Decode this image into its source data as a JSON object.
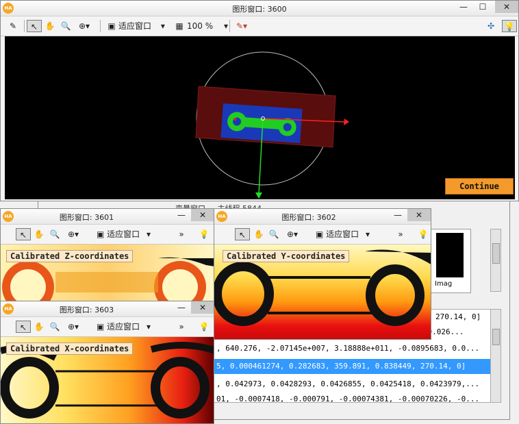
{
  "main_window": {
    "title": "图形窗口: 3600",
    "logo": "HA",
    "min": "—",
    "max": "☐",
    "close": "✕",
    "fit_label": "适应窗口",
    "zoom_label": "100 %",
    "continue_label": "Continue"
  },
  "back_window": {
    "title_fragment": "变量窗口  ...  主线程 5844"
  },
  "win3601": {
    "title": "图形窗口: 3601",
    "fit_label": "适应窗口",
    "canvas_label": "Calibrated Z-coordinates"
  },
  "win3602": {
    "title": "图形窗口: 3602",
    "fit_label": "适应窗口",
    "canvas_label": "Calibrated Y-coordinates"
  },
  "win3603": {
    "title": "图形窗口: 3603",
    "fit_label": "适应窗口",
    "canvas_label": "Calibrated X-coordinates"
  },
  "more_chevrons": "»",
  "var_rows": [
    "270.14, 0]",
    ", 180.026...",
    ", 640.276, -2.07145e+007, 3.18888e+011, -0.0895683, 0.0...",
    "5, 0.000461274, 0.282683, 359.891, 0.838449, 270.14, 0]",
    ", 0.042973, 0.0428293, 0.0426855, 0.0425418, 0.0423979,...",
    "01, -0.0007418, -0.000791, -0.00074381, -0.00070226, -0..."
  ],
  "side_preview_text": "Imag",
  "colors": {
    "continue_bg": "#f39a2a",
    "selection": "#3399ff",
    "canvas": "#000000"
  }
}
